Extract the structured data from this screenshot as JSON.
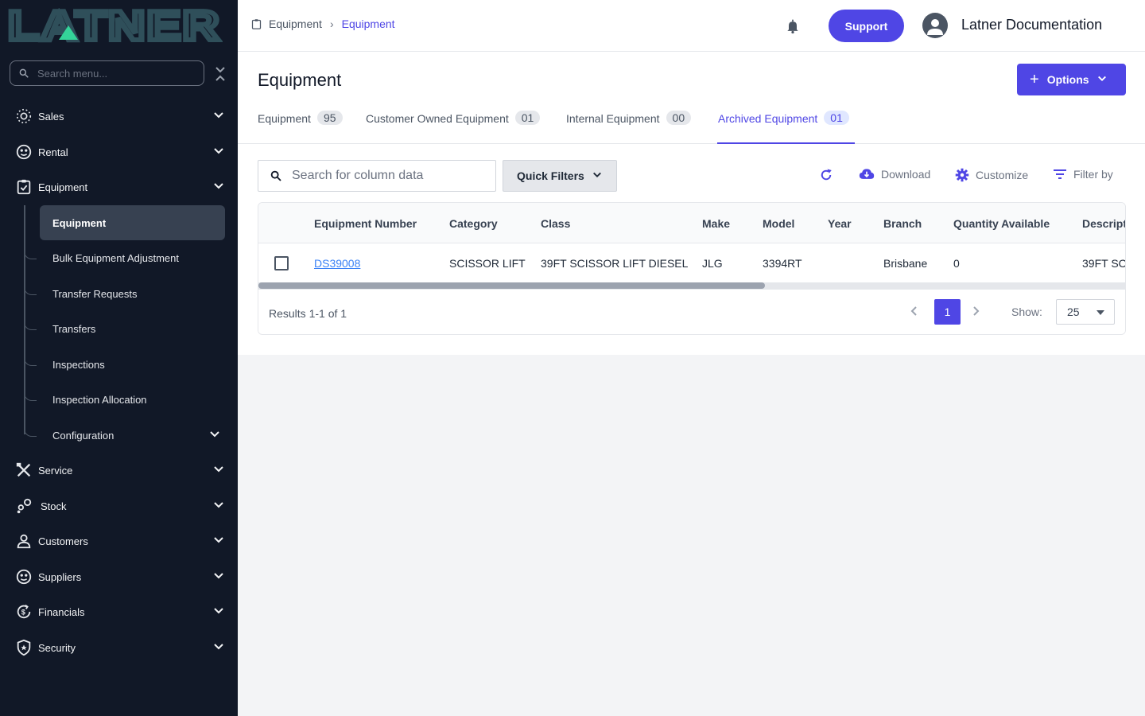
{
  "brand": {
    "logo_text": "LATNER",
    "accent": "#4f46e5",
    "sidebar_bg": "#111827"
  },
  "sidebar": {
    "search_placeholder": "Search menu...",
    "items": [
      {
        "label": "Sales",
        "icon": "sales-icon"
      },
      {
        "label": "Rental",
        "icon": "rental-icon"
      },
      {
        "label": "Equipment",
        "icon": "equipment-icon",
        "expanded": true
      },
      {
        "label": "Service",
        "icon": "service-icon"
      },
      {
        "label": "Stock",
        "icon": "stock-icon"
      },
      {
        "label": "Customers",
        "icon": "customers-icon"
      },
      {
        "label": "Suppliers",
        "icon": "suppliers-icon"
      },
      {
        "label": "Financials",
        "icon": "financials-icon"
      },
      {
        "label": "Security",
        "icon": "security-icon"
      }
    ],
    "equipment_sub": [
      {
        "label": "Equipment",
        "active": true
      },
      {
        "label": "Bulk Equipment Adjustment"
      },
      {
        "label": "Transfer Requests"
      },
      {
        "label": "Transfers"
      },
      {
        "label": "Inspections"
      },
      {
        "label": "Inspection Allocation"
      },
      {
        "label": "Configuration"
      }
    ]
  },
  "topbar": {
    "breadcrumb": [
      "Equipment",
      "Equipment"
    ],
    "support_label": "Support",
    "user_name": "Latner Documentation"
  },
  "page": {
    "title": "Equipment",
    "options_label": "Options",
    "tabs": [
      {
        "label": "Equipment",
        "count": "95"
      },
      {
        "label": "Customer Owned Equipment",
        "count": "01"
      },
      {
        "label": "Internal Equipment",
        "count": "00"
      },
      {
        "label": "Archived Equipment",
        "count": "01",
        "active": true
      }
    ]
  },
  "toolbar": {
    "search_placeholder": "Search for column data",
    "quick_filters_label": "Quick Filters",
    "download_label": "Download",
    "customize_label": "Customize",
    "filter_label": "Filter by"
  },
  "table": {
    "columns": [
      "Equipment Number",
      "Category",
      "Class",
      "Make",
      "Model",
      "Year",
      "Branch",
      "Quantity Available",
      "Descript"
    ],
    "rows": [
      {
        "equipment_number": "DS39008",
        "category": "SCISSOR LIFT",
        "class": "39FT SCISSOR LIFT DIESEL",
        "make": "JLG",
        "model": "3394RT",
        "year": "",
        "branch": "Brisbane",
        "quantity": "0",
        "description": "39FT SC"
      }
    ],
    "results_text": "Results 1-1 of 1",
    "current_page": "1",
    "show_label": "Show:",
    "page_size": "25"
  }
}
